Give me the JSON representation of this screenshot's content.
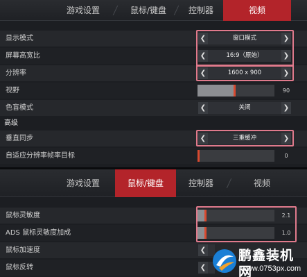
{
  "top_panel": {
    "tabs": [
      {
        "label": "游戏设置",
        "active": false
      },
      {
        "label": "鼠标/键盘",
        "active": false
      },
      {
        "label": "控制器",
        "active": false
      },
      {
        "label": "视频",
        "active": true
      }
    ],
    "rows": [
      {
        "label": "显示模式",
        "type": "selector",
        "value": "窗口模式",
        "highlighted": true
      },
      {
        "label": "屏幕高宽比",
        "type": "selector",
        "value": "16:9（原始）",
        "highlighted": true
      },
      {
        "label": "分辨率",
        "type": "selector",
        "value": "1600 x 900",
        "highlighted": true
      },
      {
        "label": "视野",
        "type": "slider",
        "value": "90",
        "level": 0.48
      },
      {
        "label": "色盲模式",
        "type": "selector",
        "value": "关闭",
        "highlighted": false
      }
    ],
    "section_title": "高级",
    "advanced_rows": [
      {
        "label": "垂直同步",
        "type": "selector",
        "value": "三重缓冲",
        "highlighted": true
      },
      {
        "label": "自适应分辨率帧率目标",
        "type": "slider",
        "value": "0",
        "level": 0.0
      }
    ]
  },
  "bottom_panel": {
    "tabs": [
      {
        "label": "游戏设置",
        "active": false
      },
      {
        "label": "鼠标/键盘",
        "active": true
      },
      {
        "label": "控制器",
        "active": false
      },
      {
        "label": "视频",
        "active": false
      }
    ],
    "rows": [
      {
        "label": "鼠标灵敏度",
        "type": "slider",
        "value": "2.1",
        "level": 0.1
      },
      {
        "label": "ADS 鼠标灵敏度加成",
        "type": "slider",
        "value": "1.0",
        "level": 0.1
      },
      {
        "label": "鼠标加速度",
        "type": "selector",
        "value": ""
      },
      {
        "label": "鼠标反转",
        "type": "selector",
        "value": ""
      }
    ]
  },
  "watermark": {
    "title": "鹏鑫装机网",
    "url": "www.0753px.com"
  },
  "colors": {
    "accent": "#b3242a",
    "highlight": "#e07a8c",
    "slider_knob": "#d9492f"
  },
  "icons": {
    "left_arrow": "chevron-left-icon",
    "right_arrow": "chevron-right-icon"
  }
}
